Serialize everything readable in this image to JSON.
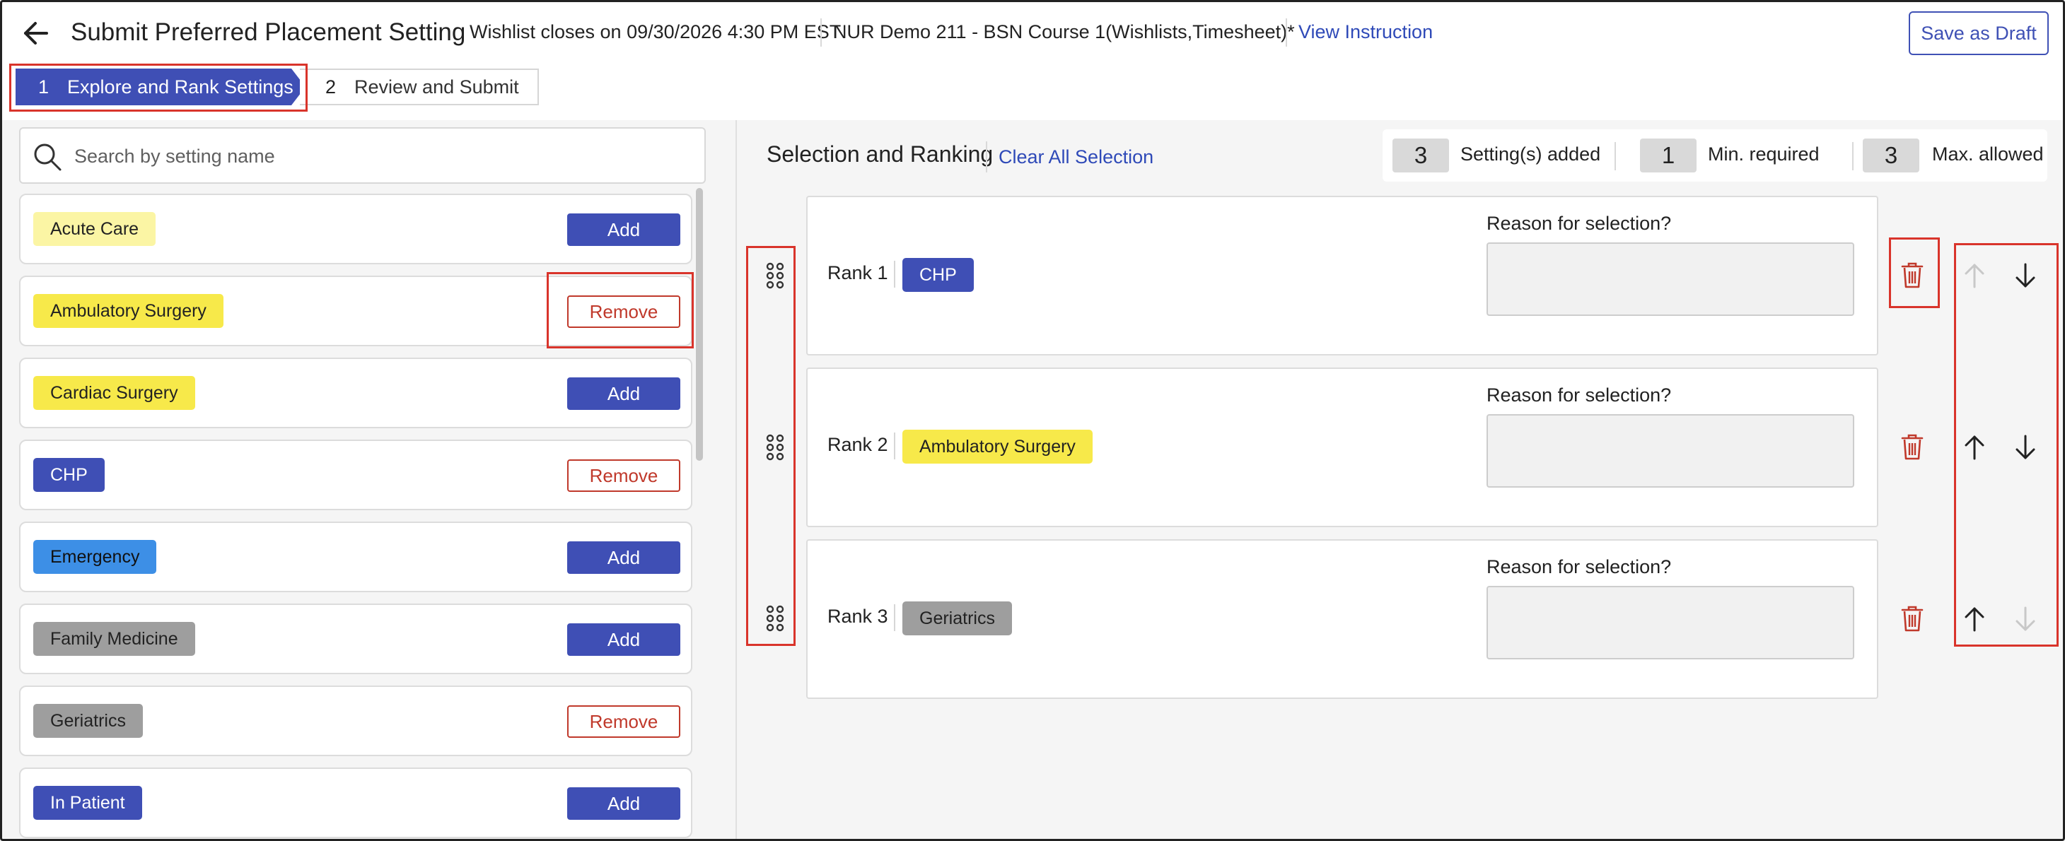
{
  "header": {
    "title": "Submit Preferred Placement Setting",
    "wishlist_info": "Wishlist closes on 09/30/2026 4:30 PM EST",
    "course_name": "NUR Demo 211 - BSN Course 1(Wishlists,Timesheet)*",
    "view_instruction": "View Instruction",
    "save_draft": "Save as Draft",
    "icons": {
      "back": "arrow-left-icon"
    }
  },
  "stepper": {
    "steps": [
      {
        "number": "1",
        "label": "Explore and Rank Settings",
        "active": true
      },
      {
        "number": "2",
        "label": "Review and Submit",
        "active": false
      }
    ]
  },
  "search": {
    "placeholder": "Search by setting name",
    "value": ""
  },
  "settings_list": [
    {
      "name": "Acute Care",
      "action": "Add",
      "tag_color": "#fbf5a4",
      "tag_text_color": "#222222"
    },
    {
      "name": "Ambulatory Surgery",
      "action": "Remove",
      "tag_color": "#f7e94a",
      "tag_text_color": "#222222"
    },
    {
      "name": "Cardiac Surgery",
      "action": "Add",
      "tag_color": "#f7e94a",
      "tag_text_color": "#222222"
    },
    {
      "name": "CHP",
      "action": "Remove",
      "tag_color": "#3f4fb5",
      "tag_text_color": "#ffffff"
    },
    {
      "name": "Emergency",
      "action": "Add",
      "tag_color": "#3d8fe6",
      "tag_text_color": "#111111"
    },
    {
      "name": "Family Medicine",
      "action": "Add",
      "tag_color": "#9e9e9e",
      "tag_text_color": "#222222"
    },
    {
      "name": "Geriatrics",
      "action": "Remove",
      "tag_color": "#9e9e9e",
      "tag_text_color": "#222222"
    },
    {
      "name": "In Patient",
      "action": "Add",
      "tag_color": "#3f4fb5",
      "tag_text_color": "#ffffff"
    }
  ],
  "selection": {
    "title": "Selection and Ranking",
    "clear_all": "Clear All Selection",
    "stats": [
      {
        "value": "3",
        "label": "Setting(s) added"
      },
      {
        "value": "1",
        "label": "Min. required"
      },
      {
        "value": "3",
        "label": "Max. allowed"
      }
    ],
    "reason_label": "Reason for selection?",
    "ranks": [
      {
        "label": "Rank 1",
        "setting": "CHP",
        "tag_color": "#3f4fb5",
        "tag_text_color": "#ffffff",
        "reason": "",
        "up_enabled": false,
        "down_enabled": true
      },
      {
        "label": "Rank 2",
        "setting": "Ambulatory Surgery",
        "tag_color": "#f7e94a",
        "tag_text_color": "#222222",
        "reason": "",
        "up_enabled": true,
        "down_enabled": true
      },
      {
        "label": "Rank 3",
        "setting": "Geriatrics",
        "tag_color": "#9e9e9e",
        "tag_text_color": "#222222",
        "reason": "",
        "up_enabled": true,
        "down_enabled": false
      }
    ],
    "icons": {
      "drag": "drag-handle-icon",
      "delete": "trash-icon",
      "up": "arrow-up-icon",
      "down": "arrow-down-icon"
    }
  },
  "colors": {
    "accent": "#3f4fb5",
    "link": "#2f4ab8",
    "danger": "#c0392b",
    "highlight": "#d9342b",
    "panel_bg": "#f5f5f5"
  }
}
